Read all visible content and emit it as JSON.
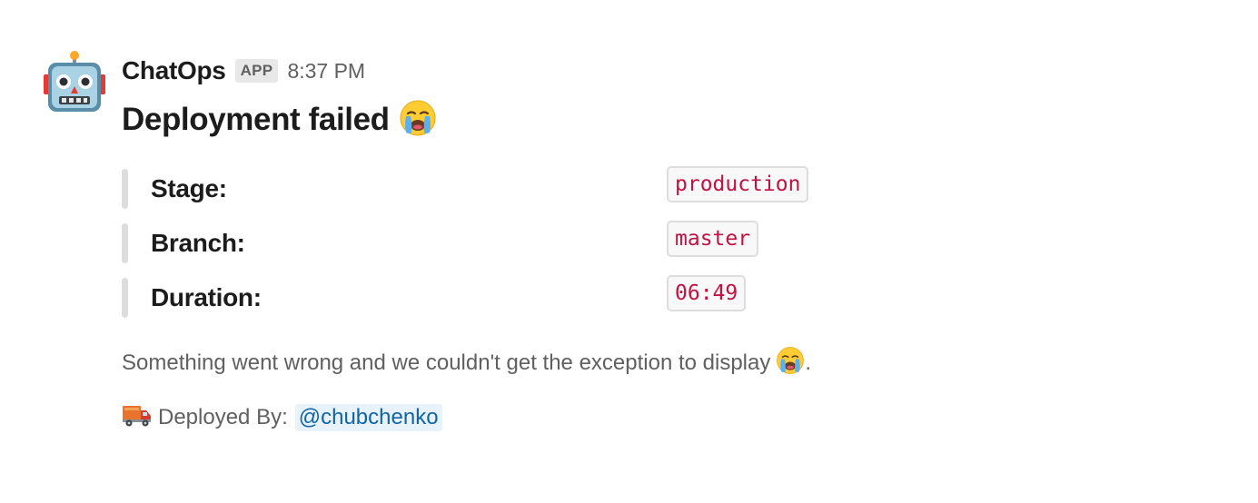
{
  "message": {
    "sender": "ChatOps",
    "badge": "APP",
    "timestamp": "8:37 PM",
    "avatar_icon": "robot-face-icon",
    "title": "Deployment failed",
    "title_emoji": "crying-face-icon",
    "fields": [
      {
        "label": "Stage:",
        "value": "production"
      },
      {
        "label": "Branch:",
        "value": "master"
      },
      {
        "label": "Duration:",
        "value": "06:49"
      }
    ],
    "note": {
      "text": "Something went wrong and we couldn't get the exception to display",
      "emoji": "crying-face-icon",
      "suffix": "."
    },
    "footer": {
      "icon": "delivery-truck-icon",
      "label": "Deployed By:",
      "mention": "@chubchenko"
    }
  },
  "colors": {
    "text": "#1d1c1d",
    "muted": "#616061",
    "code_text": "#c01343",
    "code_bg": "#f8f8f8",
    "code_border": "#dddddd",
    "field_bar": "#dddddd",
    "mention_text": "#1264a3",
    "mention_bg": "#e8f2fa",
    "badge_bg": "#e8e8e8"
  }
}
